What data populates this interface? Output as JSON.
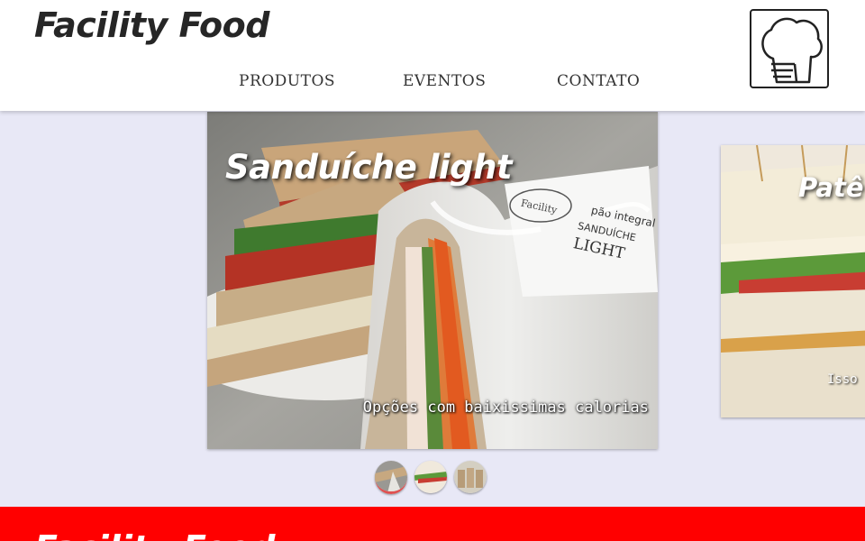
{
  "header": {
    "brand": "Facility Food",
    "logo_icon": "chef-hat-icon",
    "nav": [
      {
        "label": "PRODUTOS"
      },
      {
        "label": "EVENTOS"
      },
      {
        "label": "CONTATO"
      }
    ]
  },
  "carousel": {
    "active_index": 0,
    "slides": [
      {
        "title": "Sanduíche light",
        "caption": "Opções com baixissimas calorias"
      },
      {
        "title": "Patê",
        "caption": "Isso"
      }
    ],
    "indicator_count": 3,
    "indicator_active_color": "#e05050"
  },
  "footer": {
    "brand": "Facility Food",
    "background": "#ff0000"
  },
  "colors": {
    "page_background": "#e8e8f6",
    "header_background": "#ffffff"
  }
}
